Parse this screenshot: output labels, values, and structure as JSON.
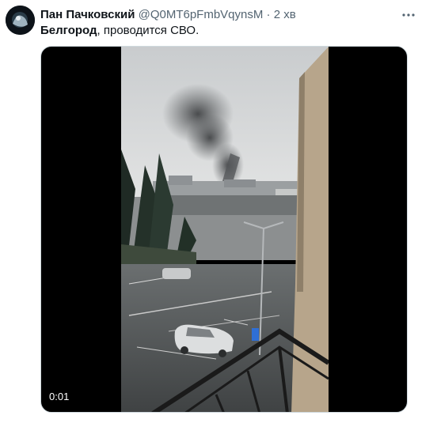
{
  "author": {
    "name": "Пан Пачковский",
    "handle": "@Q0MT6pFmbVqynsM",
    "separator": "·",
    "time": "2 хв"
  },
  "tweet": {
    "text_bold": "Белгород",
    "text_rest": ", проводится СВО."
  },
  "video": {
    "timestamp": "0:01"
  },
  "icons": {
    "more": "more-dots-icon",
    "avatar": "avatar-image"
  }
}
